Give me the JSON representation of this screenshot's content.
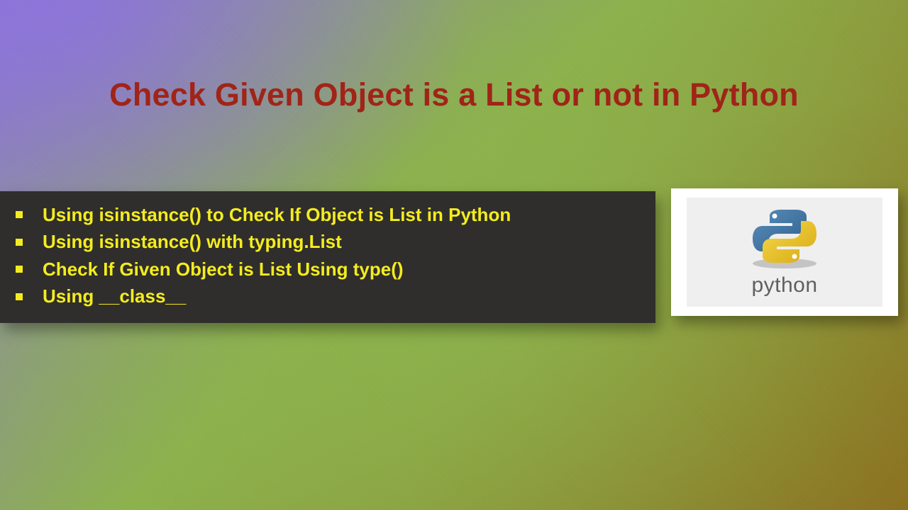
{
  "title": "Check Given Object is a List or not in Python",
  "bullets": [
    "Using isinstance() to Check If Object is List in Python",
    "Using isinstance() with typing.List",
    "Check If Given Object is List Using type()",
    "Using __class__"
  ],
  "logo": {
    "caption": "python"
  }
}
